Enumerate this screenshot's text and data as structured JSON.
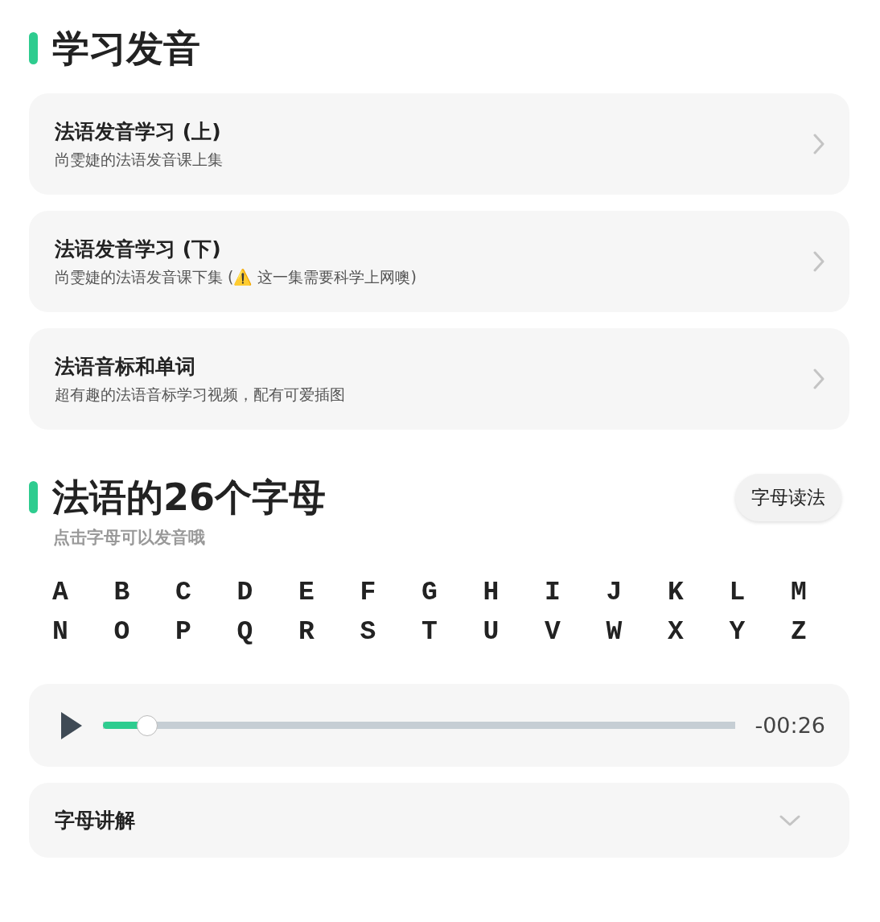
{
  "section_1": {
    "title": "学习发音",
    "courses": [
      {
        "title": "法语发音学习 (上)",
        "subtitle": "尚雯婕的法语发音课上集"
      },
      {
        "title": "法语发音学习 (下)",
        "subtitle": "尚雯婕的法语发音课下集 (⚠️ 这一集需要科学上网噢)"
      },
      {
        "title": "法语音标和单词",
        "subtitle": "超有趣的法语音标学习视频，配有可爱插图"
      }
    ]
  },
  "section_2": {
    "title": "法语的26个字母",
    "button": "字母读法",
    "hint": "点击字母可以发音哦",
    "letters": [
      "A",
      "B",
      "C",
      "D",
      "E",
      "F",
      "G",
      "H",
      "I",
      "J",
      "K",
      "L",
      "M",
      "N",
      "O",
      "P",
      "Q",
      "R",
      "S",
      "T",
      "U",
      "V",
      "W",
      "X",
      "Y",
      "Z"
    ],
    "player": {
      "level": 0.07,
      "time": "-00:26"
    },
    "accordion": {
      "title": "字母讲解",
      "expanded": false
    }
  }
}
